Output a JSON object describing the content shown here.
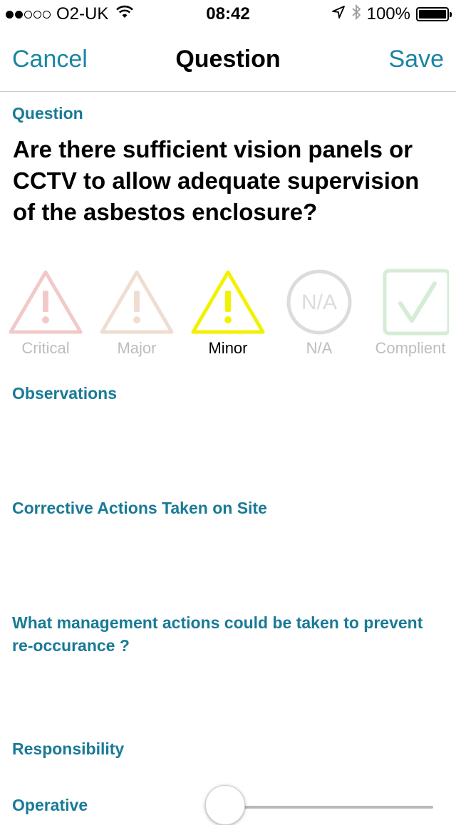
{
  "status": {
    "carrier": "O2-UK",
    "time": "08:42",
    "battery": "100%",
    "signal_bars_filled": 2,
    "signal_bars_total": 5
  },
  "nav": {
    "cancel": "Cancel",
    "title": "Question",
    "save": "Save"
  },
  "question": {
    "label": "Question",
    "text": "Are there sufficient vision panels or CCTV to allow adequate supervision of the asbestos enclosure?"
  },
  "ratings": [
    {
      "label": "Critical",
      "icon": "warning-triangle-icon",
      "color": "#f2c9c9",
      "selected": false
    },
    {
      "label": "Major",
      "icon": "warning-triangle-icon",
      "color": "#f0ddd2",
      "selected": false
    },
    {
      "label": "Minor",
      "icon": "warning-triangle-icon",
      "color": "#f2f200",
      "selected": true
    },
    {
      "label": "N/A",
      "icon": "na-circle-icon",
      "icon_text": "N/A",
      "color": "#dcdcdc",
      "selected": false
    },
    {
      "label": "Complient",
      "icon": "checkbox-tick-icon",
      "color": "#d5ecd5",
      "selected": false
    }
  ],
  "sections": {
    "observations": "Observations",
    "corrective": "Corrective Actions Taken on Site",
    "management": "What management actions could be taken to prevent re-occurance ?",
    "responsibility": "Responsibility",
    "operative": "Operative"
  },
  "colors": {
    "accent": "#1a85a3",
    "section_label": "#197a96"
  }
}
